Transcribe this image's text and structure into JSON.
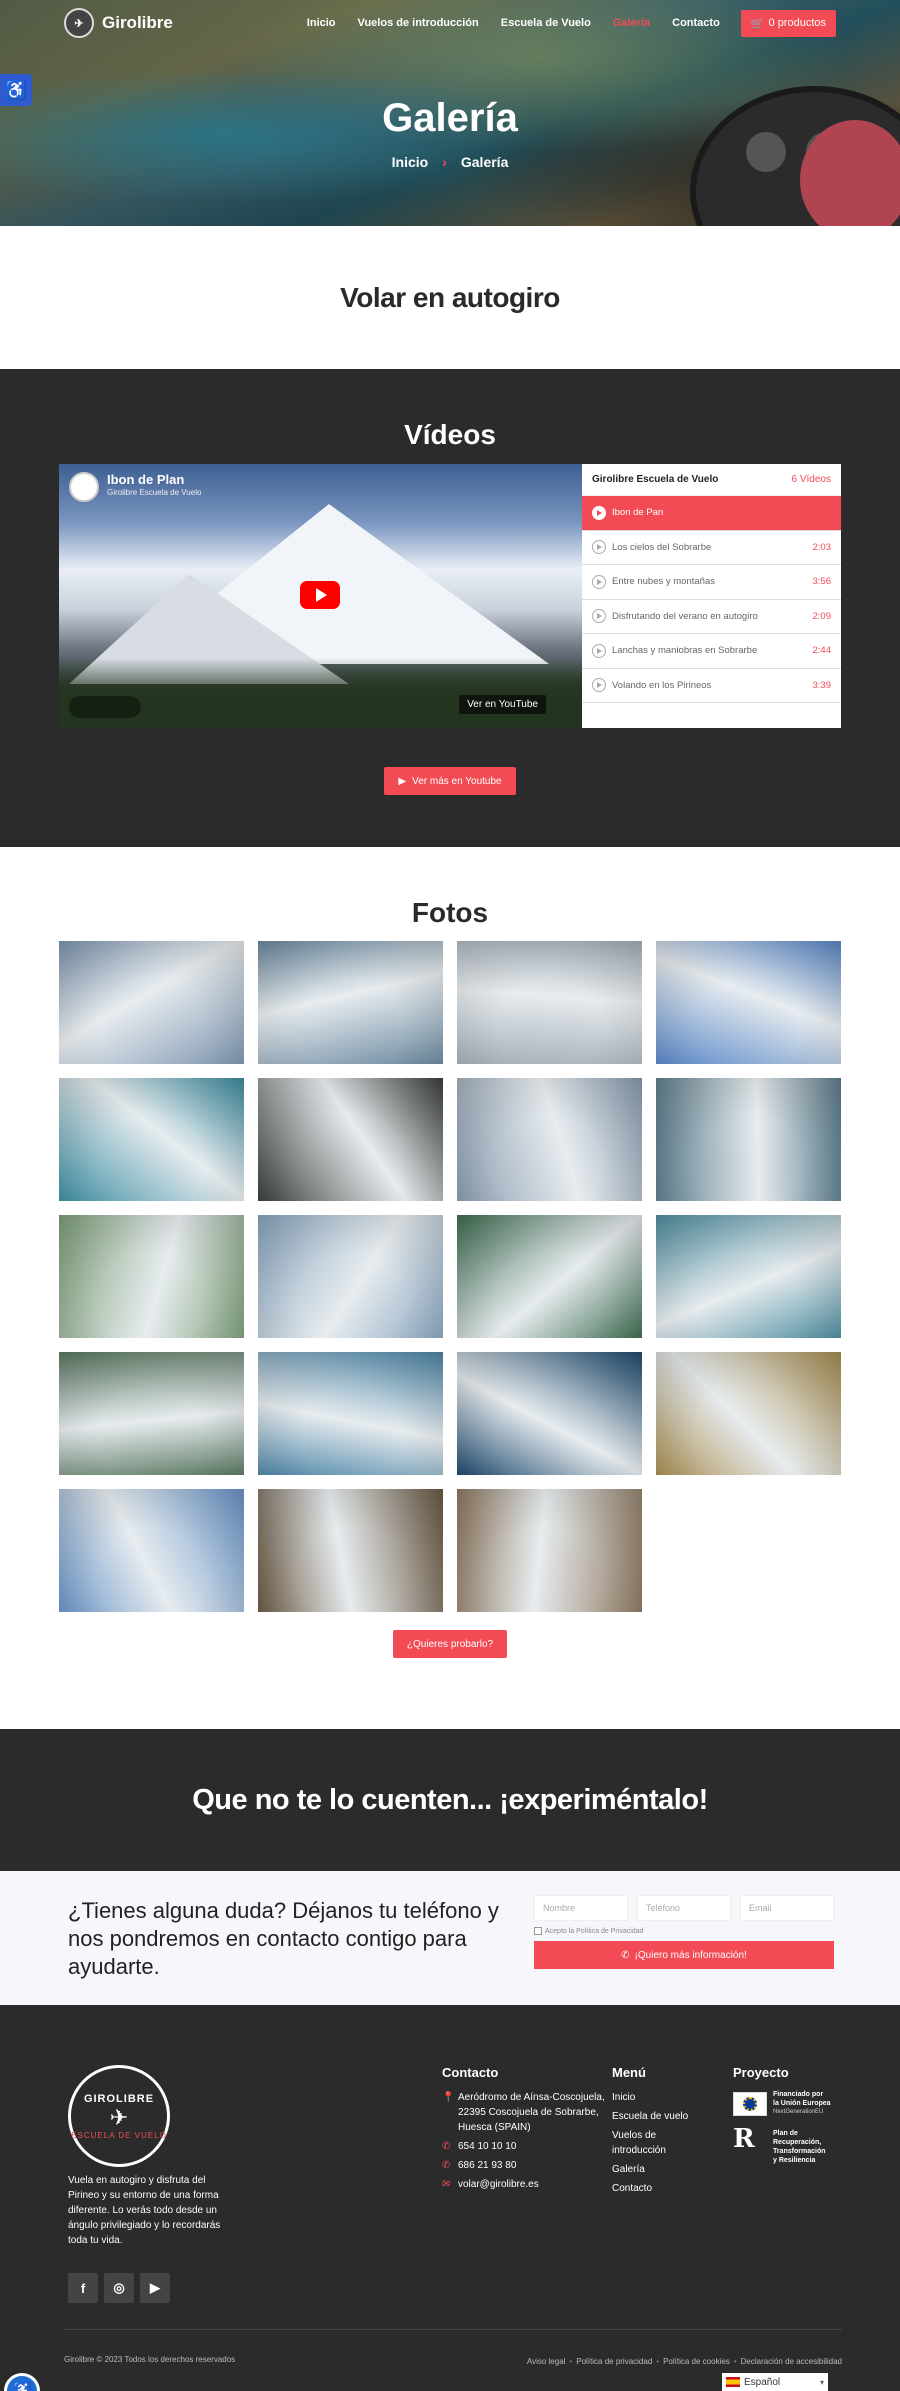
{
  "nav": {
    "brand": "Girolibre",
    "items": [
      "Inicio",
      "Vuelos de introducción",
      "Escuela de Vuelo",
      "Galería",
      "Contacto"
    ],
    "active_index": 3,
    "cart_label": "0 productos",
    "accent_color": "#f24b55"
  },
  "hero": {
    "title": "Galería",
    "breadcrumb": [
      "Inicio",
      "Galería"
    ]
  },
  "intro": {
    "heading": "Volar en autogiro"
  },
  "videos": {
    "title": "Vídeos",
    "current": {
      "title": "Ibon de Plan",
      "channel": "Girolibre Escuela de Vuelo",
      "watch_label": "Ver en  YouTube"
    },
    "playlist_title": "Girolibre Escuela de Vuelo",
    "playlist_count": "6 Vídeos",
    "items": [
      {
        "label": "Ibon de Pan",
        "duration": ""
      },
      {
        "label": "Los cielos del Sobrarbe",
        "duration": "2:03"
      },
      {
        "label": "Entre nubes y montañas",
        "duration": "3:56"
      },
      {
        "label": "Disfrutando del verano en autogiro",
        "duration": "2:09"
      },
      {
        "label": "Lanchas y maniobras en Sobrarbe",
        "duration": "2:44"
      },
      {
        "label": "Volando en los Pirineos",
        "duration": "3:39"
      }
    ],
    "cta": "Ver más en Youtube"
  },
  "photos": {
    "title": "Fotos",
    "cta": "¿Quieres probarlo?",
    "tiles": [
      "#7f96b0",
      "#6d8aa0",
      "#a6b0b8",
      "#5b88c8",
      "#3e8fa3",
      "#3b3f3c",
      "#8b9db0",
      "#5f7f8e",
      "#7fa07a",
      "#8aa6bf",
      "#3f6d52",
      "#4f8ea0",
      "#5d7a64",
      "#4f87a8",
      "#1f4a6e",
      "#a88e52",
      "#6a95c8",
      "#6b5a44",
      "#8f7a62"
    ]
  },
  "banner": {
    "heading": "Que no te lo cuenten... ¡experiméntalo!"
  },
  "contact": {
    "heading": "¿Tienes alguna duda? Déjanos tu teléfono y nos pondremos en contacto contigo para ayudarte.",
    "name_placeholder": "Nombre",
    "phone_placeholder": "Teléfono",
    "email_placeholder": "Email",
    "privacy_label": "Acepto la Política de Privacidad",
    "submit_label": "¡Quiero más información!"
  },
  "footer": {
    "logo_top": "GIROLIBRE",
    "logo_bottom": "ESCUELA DE VUELO",
    "about": "Vuela en autogiro y disfruta del Pirineo y su entorno de una forma diferente. Lo verás todo desde un ángulo privilegiado y lo recordarás toda tu vida.",
    "contact_title": "Contacto",
    "address": "Aeródromo de Aínsa-Coscojuela, 22395 Coscojuela de Sobrarbe, Huesca (SPAIN)",
    "phone1": "654 10 10 10",
    "phone2": "686 21 93 80",
    "email": "volar@girolibre.es",
    "menu_title": "Menú",
    "menu_items": [
      "Inicio",
      "Escuela de vuelo",
      "Vuelos de introducción",
      "Galería",
      "Contacto"
    ],
    "project_title": "Proyecto",
    "eu_line1": "Financiado por",
    "eu_line2": "la Unión Europea",
    "eu_line3": "NextGenerationEU",
    "prtr_line1": "Plan de",
    "prtr_line2": "Recuperación,",
    "prtr_line3": "Transformación",
    "prtr_line4": "y Resiliencia",
    "copyright": "Girolibre © 2023 Todos los derechos reservados",
    "legal": [
      "Aviso legal",
      "Política de privacidad",
      "Política de cookies",
      "Declaración de accesibilidad"
    ],
    "language": "Español"
  }
}
